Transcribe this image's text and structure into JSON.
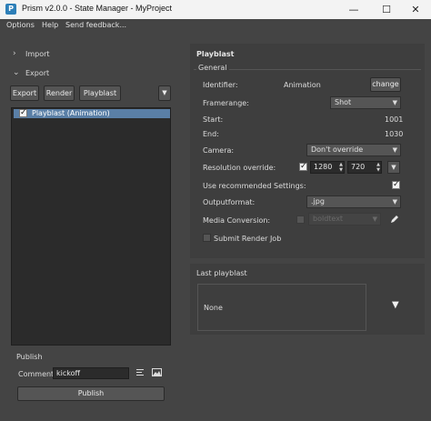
{
  "window": {
    "title": "Prism v2.0.0 - State Manager - MyProject",
    "app_icon": "P",
    "minimize_glyph": "—",
    "maximize_glyph": "☐",
    "close_glyph": "✕"
  },
  "menubar": [
    "Options",
    "Help",
    "Send feedback..."
  ],
  "left": {
    "import_label": "Import",
    "export_label": "Export",
    "buttons": {
      "export": "Export",
      "render": "Render",
      "playblast": "Playblast",
      "more": "▼"
    },
    "states": [
      {
        "label": "Playblast (Animation)",
        "checked": true
      }
    ],
    "publish_section": "Publish",
    "comment_label": "Comment:",
    "comment_value": "kickoff",
    "publish_button": "Publish"
  },
  "playblast": {
    "title": "Playblast",
    "group_title": "General",
    "identifier_label": "Identifier:",
    "identifier_value": "Animation",
    "change_button": "change",
    "framerange_label": "Framerange:",
    "framerange_value": "Shot",
    "start_label": "Start:",
    "start_value": "1001",
    "end_label": "End:",
    "end_value": "1030",
    "camera_label": "Camera:",
    "camera_value": "Don't override",
    "resolution_label": "Resolution override:",
    "resolution_checked": true,
    "res_width": "1280",
    "res_height": "720",
    "use_recommended_label": "Use recommended Settings:",
    "use_recommended_checked": true,
    "outputformat_label": "Outputformat:",
    "outputformat_value": ".jpg",
    "media_conversion_label": "Media Conversion:",
    "media_conversion_value": "boldtext",
    "submit_render_label": "Submit Render Job",
    "submit_render_checked": false
  },
  "last_playblast": {
    "title": "Last playblast",
    "value": "None"
  },
  "colors": {
    "background": "#444444",
    "panel": "#3e3e3e",
    "selection": "#5a7fa6"
  }
}
